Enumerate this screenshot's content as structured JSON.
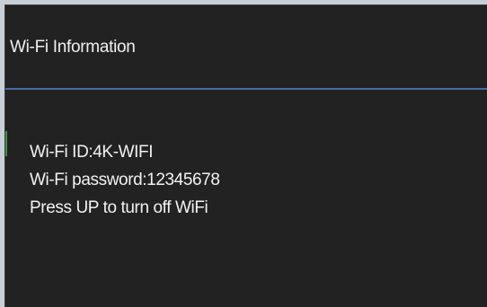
{
  "dialog": {
    "title": "Wi-Fi Information",
    "lines": {
      "wifi_id": "Wi-Fi ID:4K-WIFI",
      "wifi_password": "Wi-Fi password:12345678",
      "instruction": "Press UP to turn off WiFi"
    }
  },
  "colors": {
    "background": "#222222",
    "text": "#f2f2f2",
    "divider": "#4a6aa8",
    "accent": "#3f8f3f"
  }
}
